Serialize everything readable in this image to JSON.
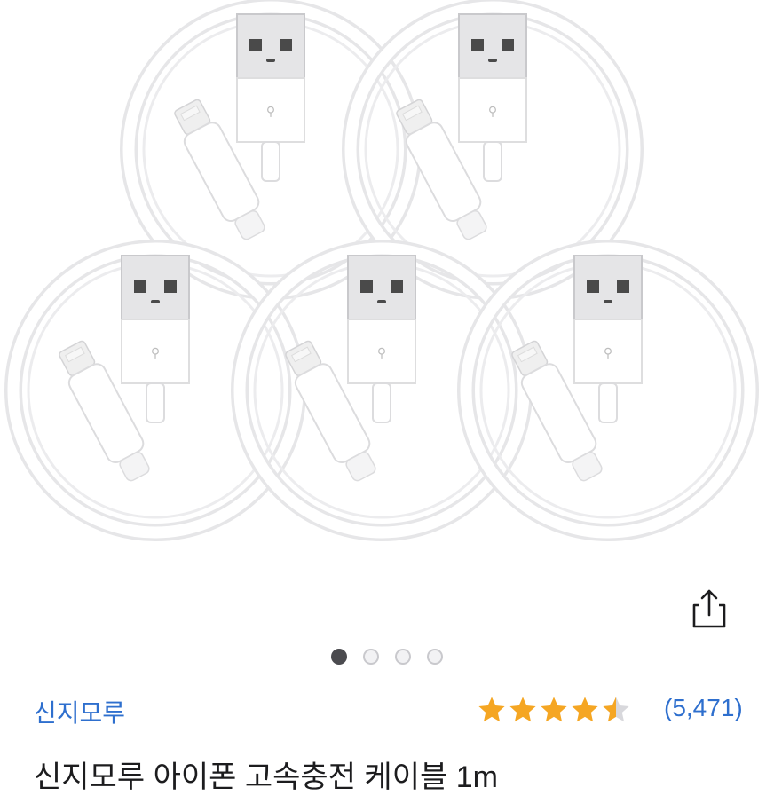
{
  "product": {
    "image_alt": "five coiled white USB-A to Lightning cables",
    "cable_count": 5,
    "brand": "신지모루",
    "title": "신지모루 아이폰 고속충전 케이블 1m",
    "rating": 4.5,
    "review_count": "(5,471)"
  },
  "carousel": {
    "total": 4,
    "active_index": 0
  },
  "icons": {
    "share": "share-icon",
    "star": "star-icon"
  },
  "colors": {
    "star": "#f5a623",
    "link": "#2e6fce",
    "dot_active": "#4b4b4f"
  }
}
